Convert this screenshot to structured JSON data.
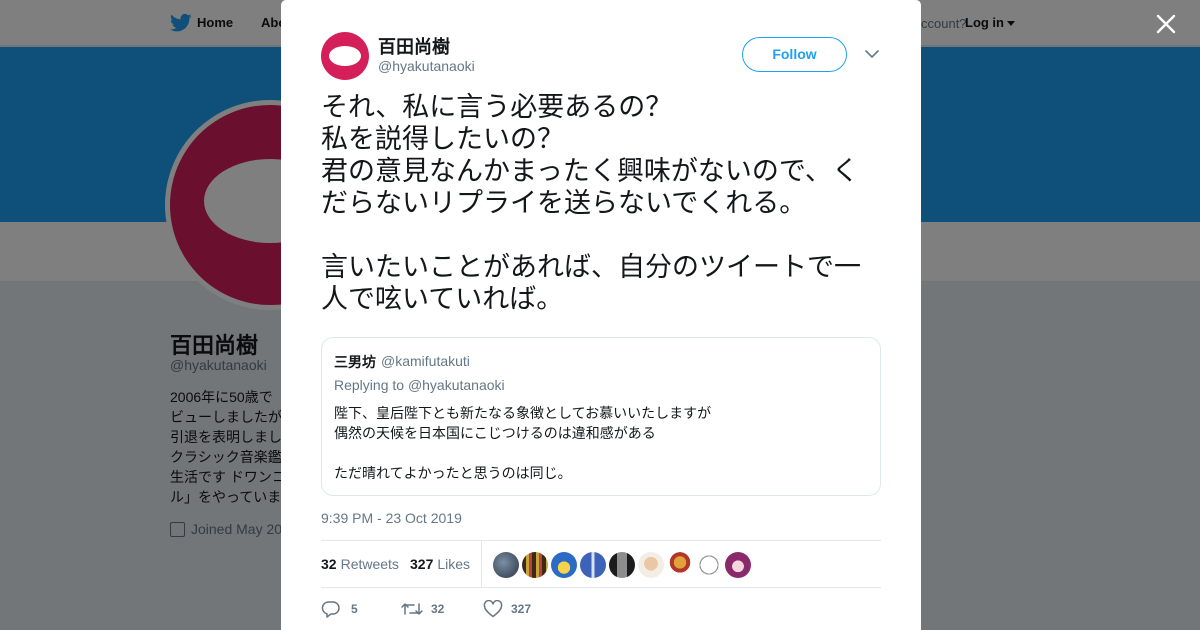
{
  "background": {
    "nav": {
      "home_label": "Home",
      "about_label": "Abo",
      "account_text": "ccount?",
      "login_label": "Log in"
    },
    "profile": {
      "name": "百田尚樹",
      "handle": "@hyakutanaoki",
      "bio_lines": [
        "2006年に50歳で",
        "ビューしましたが",
        "引退を表明しまし",
        "クラシック音楽鑑",
        "生活です ドワンコ",
        "ル」をやっていま"
      ],
      "joined": "Joined May 20"
    },
    "colors": {
      "banner": "#1da1f2",
      "brand": "#d41f5b"
    }
  },
  "modal": {
    "close_icon": "close-icon",
    "author": {
      "name": "百田尚樹",
      "handle": "@hyakutanaoki"
    },
    "follow_label": "Follow",
    "tweet_lines": [
      "それ、私に言う必要あるの？",
      "私を説得したいの？",
      "君の意見なんかまったく興味がないので、く",
      "だらないリプライを送らないでくれる。",
      "",
      "言いたいことがあれば、自分のツイートで一",
      "人で呟いていれば。"
    ],
    "quote": {
      "name": "三男坊",
      "handle": "@kamifutakuti",
      "replying_prefix": "Replying to",
      "replying_to": "@hyakutanaoki",
      "lines": [
        "陛下、皇后陛下とも新たなる象徴としてお慕いいたしますが",
        "偶然の天候を日本国にこじつけるのは違和感がある",
        "",
        "ただ晴れてよかったと思うのは同じ。"
      ]
    },
    "timestamp": "9:39 PM - 23 Oct 2019",
    "stats": {
      "retweets_count": "32",
      "retweets_label": "Retweets",
      "likes_count": "327",
      "likes_label": "Likes"
    },
    "actions": {
      "reply_count": "5",
      "retweet_count": "32",
      "like_count": "327"
    },
    "colors": {
      "accent": "#1da1f2",
      "muted": "#657786",
      "text": "#14171a"
    }
  }
}
